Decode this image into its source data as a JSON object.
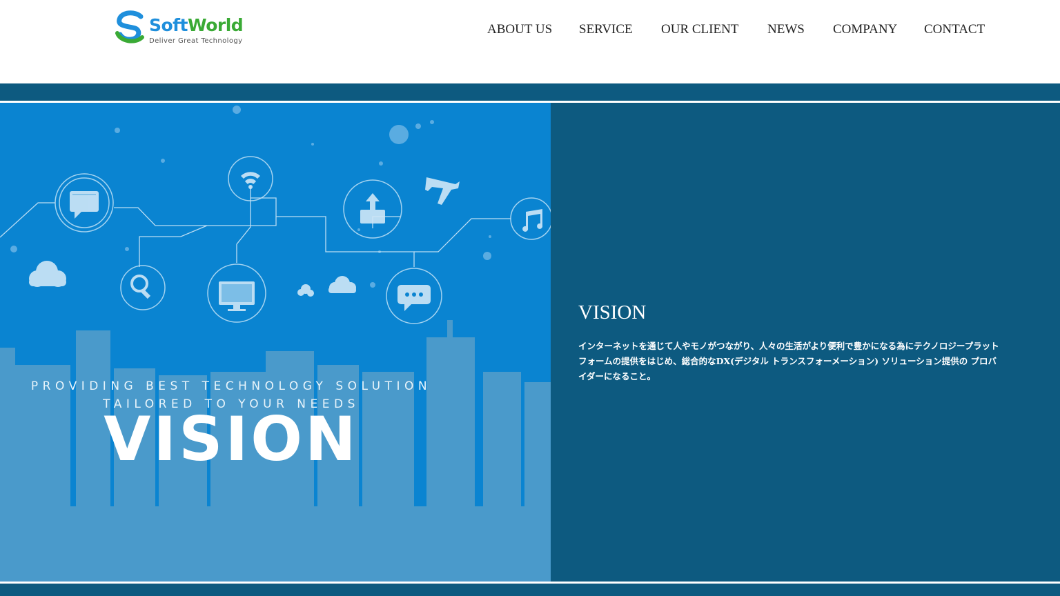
{
  "brand": {
    "name_part1": "Soft",
    "name_part2": "World",
    "tagline": "Deliver Great Technology",
    "colors": {
      "blue": "#1f8fdc",
      "green": "#3aaa35"
    }
  },
  "nav": {
    "items": [
      {
        "label": "ABOUT US"
      },
      {
        "label": "SERVICE"
      },
      {
        "label": "OUR CLIENT"
      },
      {
        "label": "NEWS"
      },
      {
        "label": "COMPANY"
      },
      {
        "label": "CONTACT"
      }
    ]
  },
  "hero": {
    "title": "VISION",
    "subtitle_line1": "PROVIDING BEST TECHNOLOGY SOLUTION",
    "subtitle_line2": "TAILORED TO YOUR NEEDS",
    "icons": [
      "chat-icon",
      "wifi-icon",
      "upload-icon",
      "airplane-icon",
      "music-icon",
      "search-icon",
      "monitor-icon",
      "message-dots-icon",
      "cloud-icon"
    ]
  },
  "vision": {
    "heading": "VISION",
    "text": "インターネットを通じて人やモノがつながり、人々の生活がより便利で豊かになる為にテクノロジープラットフォームの提供をはじめ、総合的なDX(デジタル トランスフォーメーション) ソリューション提供の プロバイダーになること。"
  },
  "colors": {
    "dark_band": "#0d5a80",
    "hero_blue": "#0a84d1",
    "city_blue": "#4a9acb"
  }
}
